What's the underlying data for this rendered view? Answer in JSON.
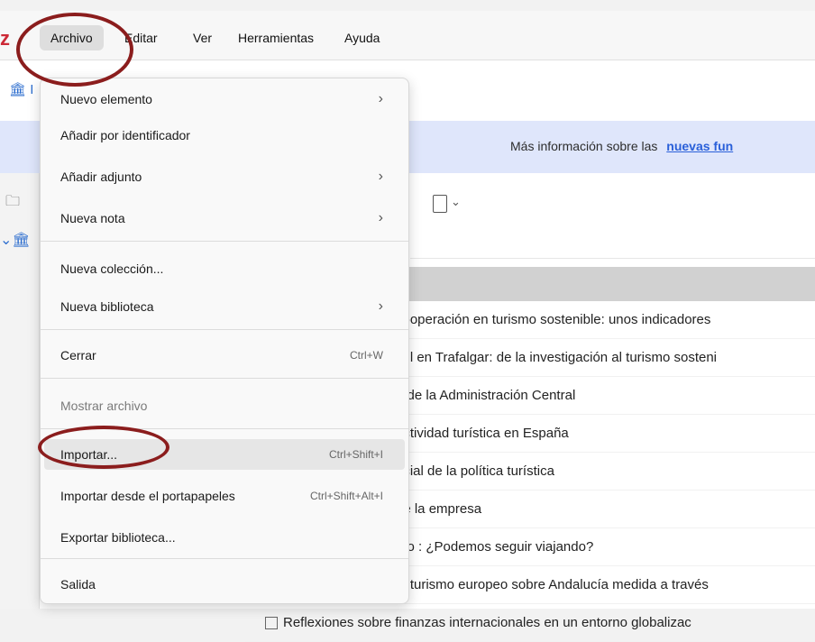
{
  "app": {
    "logo": "z"
  },
  "menubar": {
    "items": [
      "Archivo",
      "Editar",
      "Ver",
      "Herramientas",
      "Ayuda"
    ]
  },
  "library_tab": "I",
  "banner": {
    "text": "Más información sobre las",
    "link": "nuevas fun"
  },
  "items": [
    "cooperación en turismo sostenible: unos indicadores",
    "zul en Trafalgar: de la investigación al turismo sosteni",
    "a de la Administración Central",
    "actividad turística en España",
    "acial de la política turística",
    "de la empresa",
    "mo : ¿Podemos seguir viajando?",
    "el turismo europeo sobre Andalucía medida a través",
    "Reflexiones sobre finanzas internacionales en un entorno globalizac"
  ],
  "dropdown": {
    "nuevo_elemento": "Nuevo elemento",
    "anadir_identificador": "Añadir por identificador",
    "anadir_adjunto": "Añadir adjunto",
    "nueva_nota": "Nueva nota",
    "nueva_coleccion": "Nueva colección...",
    "nueva_biblioteca": "Nueva biblioteca",
    "cerrar": "Cerrar",
    "cerrar_shortcut": "Ctrl+W",
    "mostrar_archivo": "Mostrar archivo",
    "importar": "Importar...",
    "importar_shortcut": "Ctrl+Shift+I",
    "importar_portapapeles": "Importar desde el portapapeles",
    "importar_portapapeles_shortcut": "Ctrl+Shift+Alt+I",
    "exportar": "Exportar biblioteca...",
    "salida": "Salida"
  },
  "colors": {
    "annotation": "#8b1d1d",
    "banner": "#dfe6fb",
    "link": "#2a60d9"
  }
}
